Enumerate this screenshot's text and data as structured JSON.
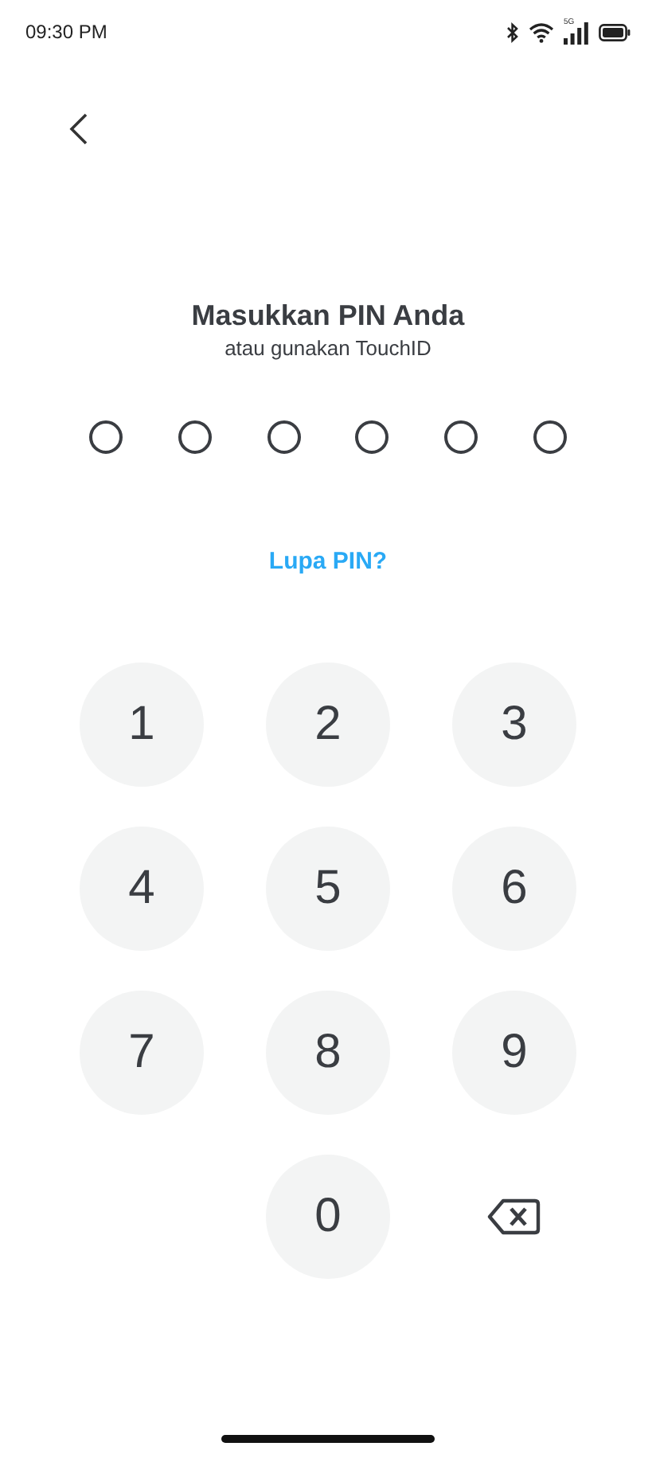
{
  "status_bar": {
    "time": "09:30 PM",
    "network": "5G"
  },
  "header": {
    "title": "Masukkan PIN Anda",
    "subtitle": "atau gunakan TouchID"
  },
  "pin_dots": [
    {
      "filled": false
    },
    {
      "filled": false
    },
    {
      "filled": false
    },
    {
      "filled": false
    },
    {
      "filled": false
    },
    {
      "filled": false
    }
  ],
  "forgot_link": "Lupa PIN?",
  "keypad": [
    {
      "kind": "digit",
      "label": "1"
    },
    {
      "kind": "digit",
      "label": "2"
    },
    {
      "kind": "digit",
      "label": "3"
    },
    {
      "kind": "digit",
      "label": "4"
    },
    {
      "kind": "digit",
      "label": "5"
    },
    {
      "kind": "digit",
      "label": "6"
    },
    {
      "kind": "digit",
      "label": "7"
    },
    {
      "kind": "digit",
      "label": "8"
    },
    {
      "kind": "digit",
      "label": "9"
    },
    {
      "kind": "blank"
    },
    {
      "kind": "digit",
      "label": "0"
    },
    {
      "kind": "backspace"
    }
  ]
}
